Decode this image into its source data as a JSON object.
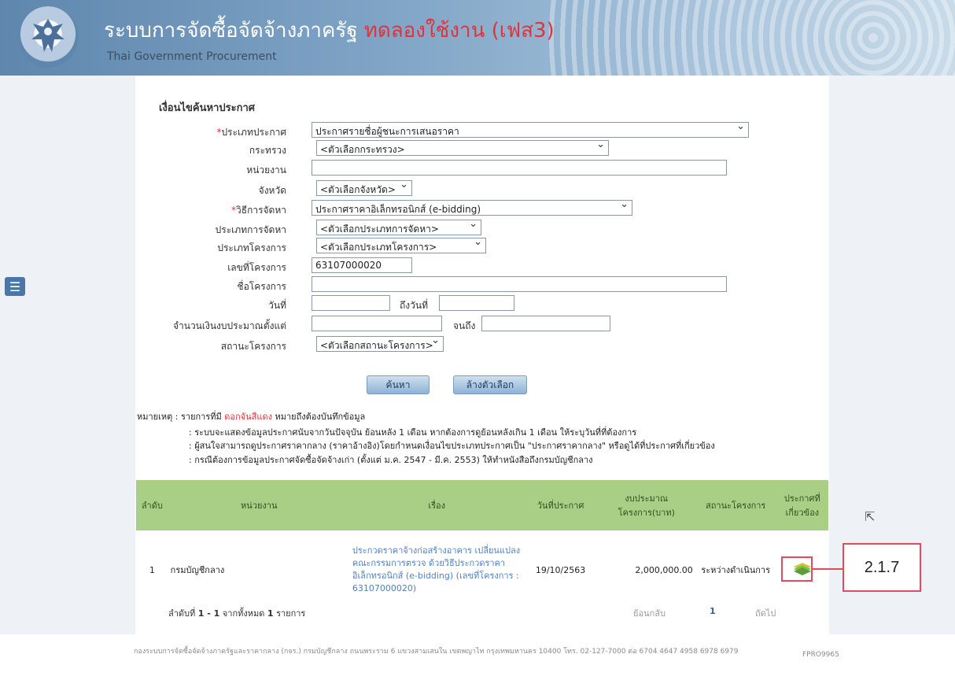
{
  "header": {
    "title_th": "ระบบการจัดซื้อจัดจ้างภาครัฐ",
    "title_trial": "ทดลองใช้งาน (เฟส3)",
    "title_en": "Thai Government Procurement"
  },
  "menu_icon": "hamburger-menu-icon",
  "search": {
    "title": "เงื่อนไขค้นหาประกาศ",
    "announce_type": {
      "label": "ประเภทประกาศ",
      "value": "ประกาศรายชื่อผู้ชนะการเสนอราคา"
    },
    "ministry": {
      "label": "กระทรวง",
      "value": "<ตัวเลือกกระทรวง>"
    },
    "agency": {
      "label": "หน่วยงาน",
      "value": ""
    },
    "province": {
      "label": "จังหวัด",
      "value": "<ตัวเลือกจังหวัด>"
    },
    "method": {
      "label": "วิธีการจัดหา",
      "value": "ประกาศราคาอิเล็กทรอนิกส์ (e-bidding)"
    },
    "proc_type": {
      "label": "ประเภทการจัดหา",
      "value": "<ตัวเลือกประเภทการจัดหา>"
    },
    "project_type": {
      "label": "ประเภทโครงการ",
      "value": "<ตัวเลือกประเภทโครงการ>"
    },
    "project_no": {
      "label": "เลขที่โครงการ",
      "value": "63107000020"
    },
    "project_name": {
      "label": "ชื่อโครงการ",
      "value": ""
    },
    "date": {
      "label": "วันที่",
      "value": "",
      "to_label": "ถึงวันที่",
      "to_value": ""
    },
    "budget": {
      "label": "จำนวนเงินงบประมาณตั้งแต่",
      "value": "",
      "to_label": "จนถึง",
      "to_value": ""
    },
    "status": {
      "label": "สถานะโครงการ",
      "value": "<ตัวเลือกสถานะโครงการ>"
    },
    "search_btn": "ค้นหา",
    "clear_btn": "ล้างตัวเลือก"
  },
  "notes": {
    "prefix": "หมายเหตุ : รายการที่มี",
    "red": "ดอกจันสีแดง",
    "suffix": "หมายถึงต้องบันทึกข้อมูล",
    "line1": ": ระบบจะแสดงข้อมูลประกาศนับจากวันปัจจุบัน ย้อนหลัง 1 เดือน หากต้องการดูย้อนหลังเกิน 1 เดือน ให้ระบุวันที่ที่ต้องการ",
    "line2": ": ผู้สนใจสามารถดูประกาศราคากลาง (ราคาอ้างอิง)โดยกำหนดเงื่อนไขประเภทประกาศเป็น \"ประกาศราคากลาง\" หรือดูได้ที่ประกาศที่เกี่ยวข้อง",
    "line3": ": กรณีต้องการข้อมูลประกาศจัดซื้อจัดจ้างเก่า (ตั้งแต่ ม.ค. 2547 - มี.ค. 2553) ให้ทำหนังสือถึงกรมบัญชีกลาง"
  },
  "table": {
    "headers": {
      "no": "ลำดับ",
      "agency": "หน่วยงาน",
      "subject": "เรื่อง",
      "date": "วันที่ประกาศ",
      "budget": "งบประมาณโครงการ(บาท)",
      "status": "สถานะโครงการ",
      "related": "ประกาศที่เกี่ยวข้อง"
    },
    "rows": [
      {
        "no": "1",
        "agency": "กรมบัญชีกลาง",
        "subject": "ประกวดราคาจ้างก่อสร้างอาคาร เปลี่ยนแปลงคณะกรรมการตรวจ ด้วยวิธีประกวดราคาอิเล็กทรอนิกส์ (e-bidding) (เลขที่โครงการ : 63107000020)",
        "date": "19/10/2563",
        "budget": "2,000,000.00",
        "status": "ระหว่างดำเนินการ",
        "icon": "document-stack-icon"
      }
    ]
  },
  "pager": {
    "summary_prefix": "ลำดับที่",
    "summary_range": "1 - 1",
    "summary_mid": "จากทั้งหมด",
    "summary_total": "1",
    "summary_suffix": "รายการ",
    "back": "ย้อนกลับ",
    "page": "1",
    "next": "ถัดไป"
  },
  "footer": {
    "text": "กองระบบการจัดซื้อจัดจ้างภาครัฐและราคากลาง (กจร.) กรมบัญชีกลาง ถนนพระราม 6 แขวงสามเสนใน เขตพญาไท กรุงเทพมหานคร 10400 โทร. 02-127-7000 ต่อ 6704 4647 4958 6978 6979",
    "code": "FPRO9965"
  },
  "callout": {
    "label": "2.1.7",
    "color": "#e34b5b"
  }
}
